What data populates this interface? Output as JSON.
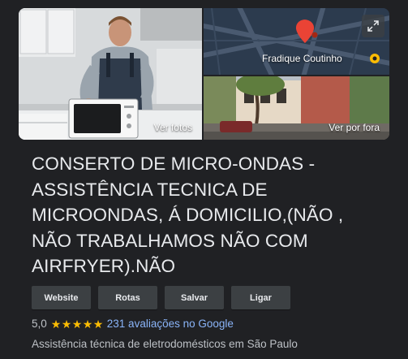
{
  "gallery": {
    "photos_label": "Ver fotos",
    "street_label": "Ver por fora",
    "map_place_label": "Fradique Coutinho"
  },
  "business": {
    "name": "CONSERTO DE MICRO-ONDAS - ASSISTÊNCIA TECNICA DE MICROONDAS, Á DOMICILIO,(NÃO , NÃO TRABALHAMOS NÃO COM AIRFRYER).NÃO",
    "rating": "5,0",
    "stars": 5,
    "reviews_link": "231 avaliações no Google",
    "category": "Assistência técnica de eletrodomésticos em São Paulo"
  },
  "actions": {
    "website": "Website",
    "routes": "Rotas",
    "save": "Salvar",
    "call": "Ligar"
  },
  "colors": {
    "background": "#202124",
    "button": "#3c4043",
    "star": "#fbbc04",
    "link": "#8ab4f8",
    "map_pin": "#ea4335"
  }
}
